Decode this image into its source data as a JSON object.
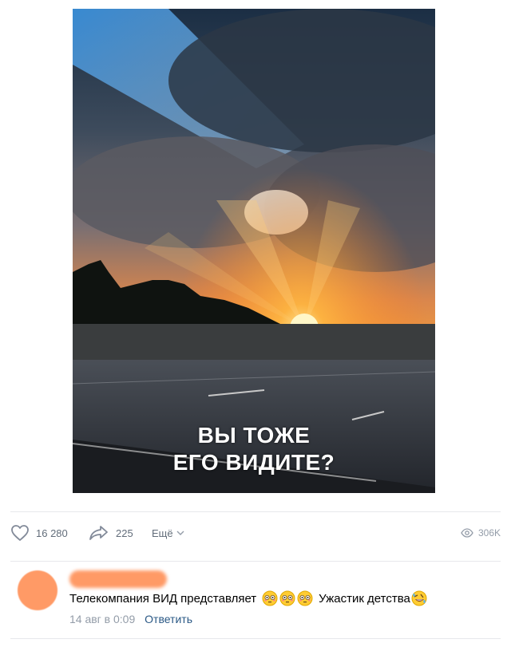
{
  "post": {
    "image_caption_line1": "ВЫ ТОЖЕ",
    "image_caption_line2": "ЕГО ВИДИТЕ?"
  },
  "actions": {
    "likes": "16 280",
    "shares": "225",
    "more_label": "Ещё",
    "views": "306K"
  },
  "comment": {
    "text_part1": "Телекомпания ВИД представляет",
    "text_part2": "Ужастик детства",
    "date": "14 авг в 0:09",
    "reply_label": "Ответить"
  },
  "icons": {
    "like": "heart-icon",
    "share": "share-arrow-icon",
    "more": "chevron-down-icon",
    "views": "eye-icon"
  },
  "colors": {
    "text_secondary": "#626d7a",
    "link": "#2a5885",
    "avatar_blur": "#ff9a66"
  }
}
